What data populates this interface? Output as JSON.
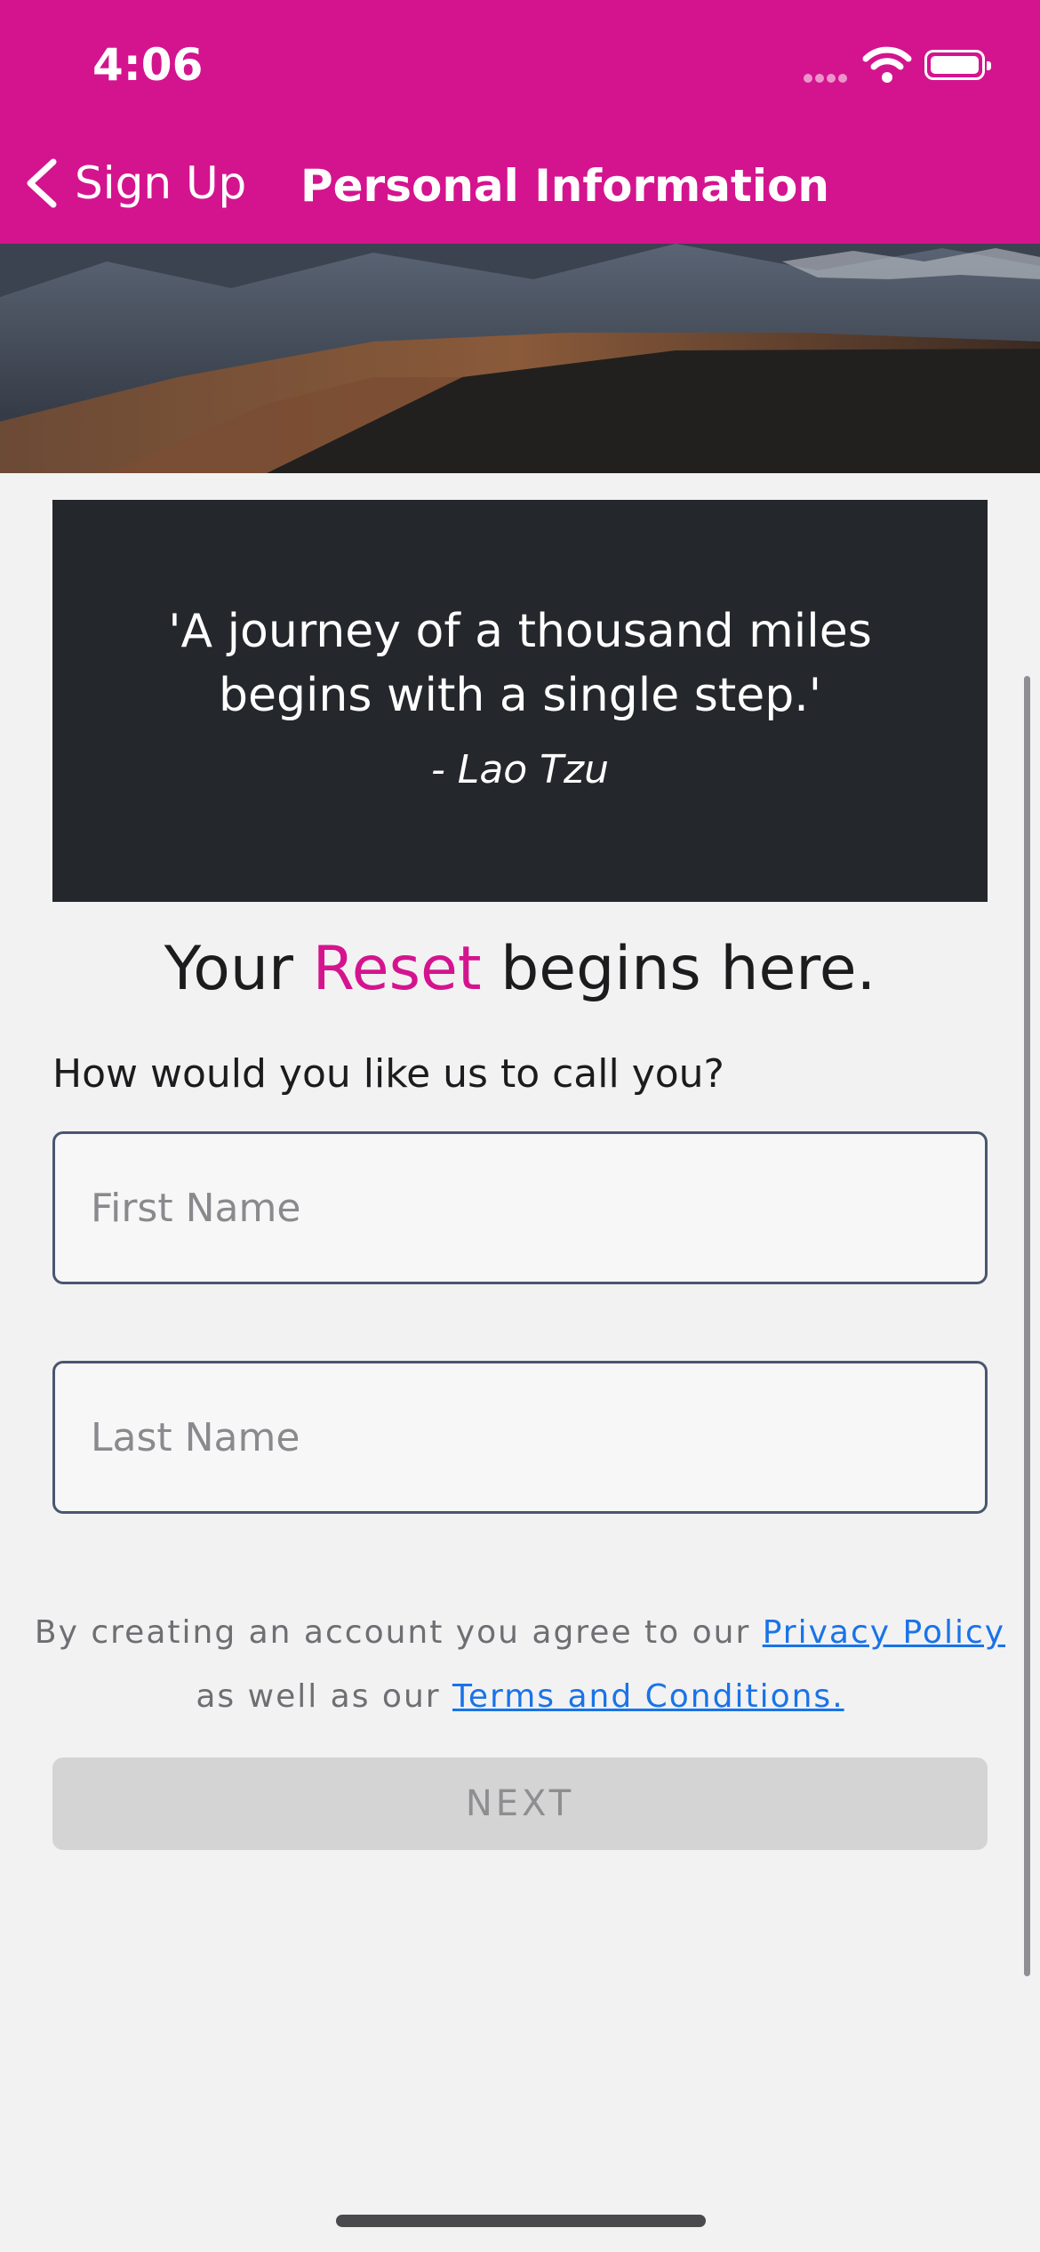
{
  "status_bar": {
    "time": "4:06"
  },
  "nav": {
    "back_label": "Sign Up",
    "title": "Personal Information"
  },
  "quote": {
    "text": "'A journey of a thousand miles begins with a single step.'",
    "author": "- Lao Tzu"
  },
  "headline": {
    "before": "Your ",
    "accent": "Reset",
    "after": " begins here."
  },
  "question": "How would you like us to call you?",
  "form": {
    "first_name_placeholder": "First Name",
    "first_name_value": "",
    "last_name_placeholder": "Last Name",
    "last_name_value": ""
  },
  "legal": {
    "part1": "By creating an account you agree to our ",
    "privacy_link": "Privacy Policy",
    "part2": "as well as our ",
    "terms_link": "Terms and Conditions."
  },
  "next_button": "NEXT",
  "colors": {
    "brand": "#d4148e",
    "card": "#24272b",
    "link": "#1a73e8"
  },
  "icons": [
    "wifi-icon",
    "battery-icon",
    "signal-icon",
    "chevron-left-icon"
  ]
}
